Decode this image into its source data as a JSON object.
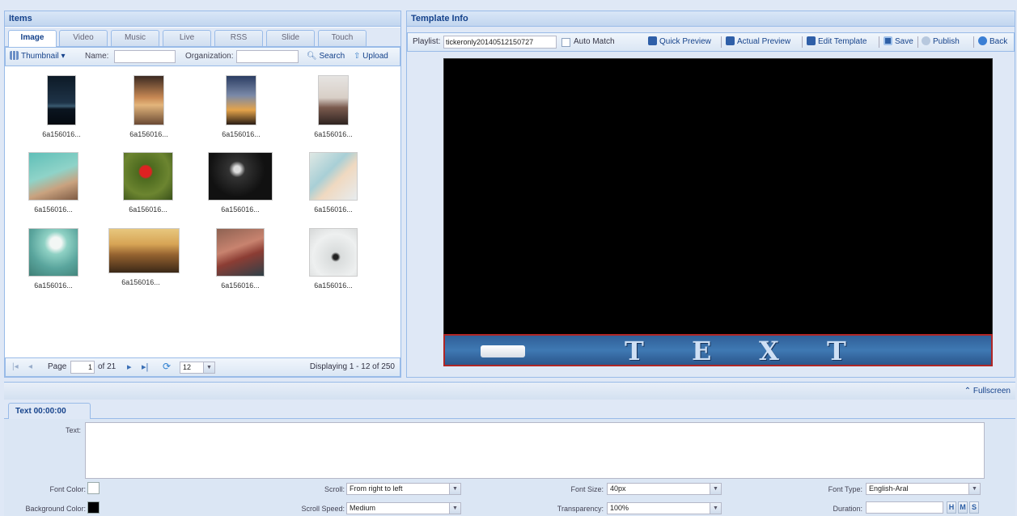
{
  "items_panel": {
    "title": "Items",
    "tabs": [
      "Image",
      "Video",
      "Music",
      "Live",
      "RSS",
      "Slide",
      "Touch"
    ],
    "toolbar": {
      "view_label": "Thumbnail",
      "name_label": "Name:",
      "name_value": "",
      "org_label": "Organization:",
      "org_value": "",
      "search_label": "Search",
      "upload_label": "Upload"
    },
    "thumbnails": [
      {
        "caption": "6a156016...",
        "icon": "night-lake-photo"
      },
      {
        "caption": "6a156016...",
        "icon": "sunset-girl-photo"
      },
      {
        "caption": "6a156016...",
        "icon": "sunset-silhouette-photo"
      },
      {
        "caption": "6a156016...",
        "icon": "pebbles-photo"
      },
      {
        "caption": "6a156016...",
        "icon": "beach-girl-photo"
      },
      {
        "caption": "6a156016...",
        "icon": "red-flower-photo"
      },
      {
        "caption": "6a156016...",
        "icon": "white-flowers-photo"
      },
      {
        "caption": "6a156016...",
        "icon": "petals-photo"
      },
      {
        "caption": "6a156016...",
        "icon": "dandelion-photo"
      },
      {
        "caption": "6a156016...",
        "icon": "sunset-field-photo"
      },
      {
        "caption": "6a156016...",
        "icon": "girl-closeup-photo"
      },
      {
        "caption": "6a156016...",
        "icon": "glass-flower-photo"
      }
    ],
    "pager": {
      "page_label": "Page",
      "page_value": "1",
      "of_label": "of 21",
      "page_size": "12",
      "display_text": "Displaying 1 - 12 of 250"
    }
  },
  "template_panel": {
    "title": "Template Info",
    "playlist_label": "Playlist:",
    "playlist_value": "tickeronly20140512150727",
    "auto_match_label": "Auto Match",
    "buttons": {
      "quick_preview": "Quick Preview",
      "actual_preview": "Actual Preview",
      "edit_template": "Edit Template",
      "save": "Save",
      "publish": "Publish",
      "back": "Back"
    },
    "ticker_letters": [
      "T",
      "E",
      "X",
      "T"
    ]
  },
  "fullscreen_label": "Fullscreen",
  "text_panel": {
    "tab_label": "Text 00:00:00",
    "text_label": "Text:",
    "text_value": "",
    "font_color_label": "Font Color:",
    "bg_color_label": "Background Color:",
    "scroll_label": "Scroll:",
    "scroll_value": "From right to left",
    "scroll_speed_label": "Scroll Speed:",
    "scroll_speed_value": "Medium",
    "font_size_label": "Font Size:",
    "font_size_value": "40px",
    "transparency_label": "Transparency:",
    "transparency_value": "100%",
    "font_type_label": "Font Type:",
    "font_type_value": "English-Aral",
    "duration_label": "Duration:",
    "duration_value": "",
    "hms": [
      "H",
      "M",
      "S"
    ]
  },
  "colors": {
    "accent": "#15428b",
    "font_color": "#ffffff",
    "background_color": "#000000",
    "ticker_bg": "#2c5d97"
  }
}
